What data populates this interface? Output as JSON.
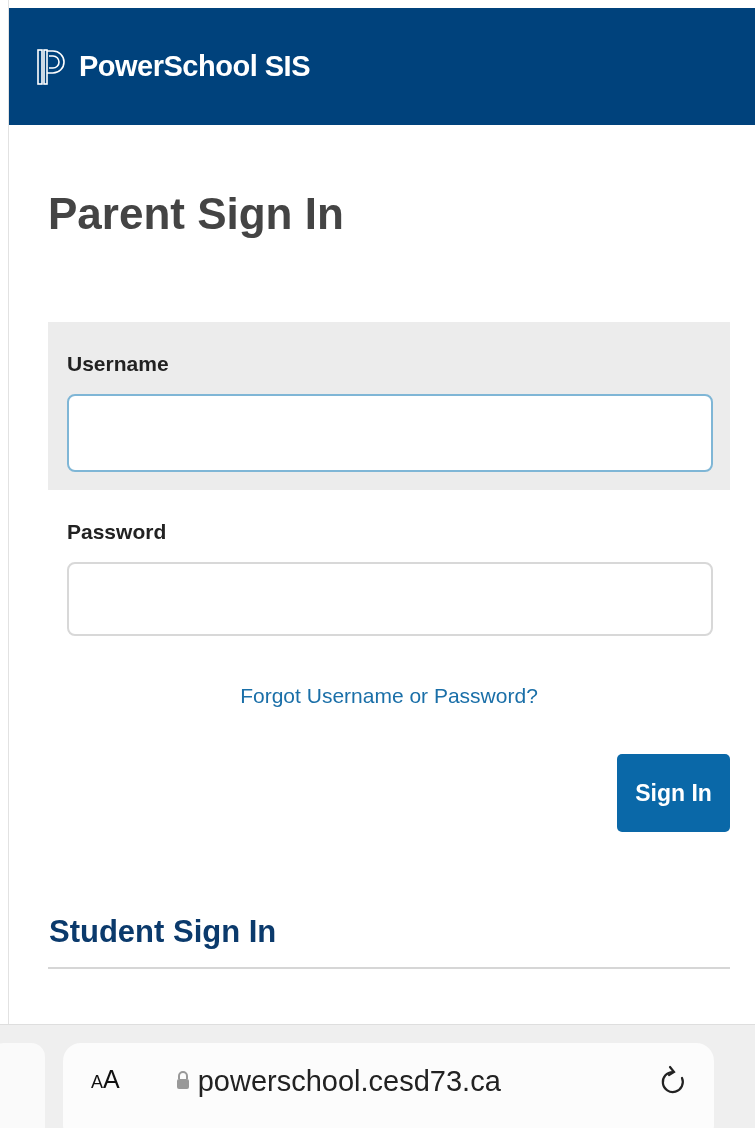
{
  "header": {
    "title": "PowerSchool SIS"
  },
  "page_title": "Parent Sign In",
  "fields": [
    {
      "label": "Username",
      "focused": true
    },
    {
      "label": "Password",
      "focused": false
    }
  ],
  "forgot_link": "Forgot Username or Password?",
  "sign_in_button": "Sign In",
  "student_section": "Student Sign In",
  "browser_bar": {
    "text_size": "AA",
    "url": "powerschool.cesd73.ca"
  }
}
